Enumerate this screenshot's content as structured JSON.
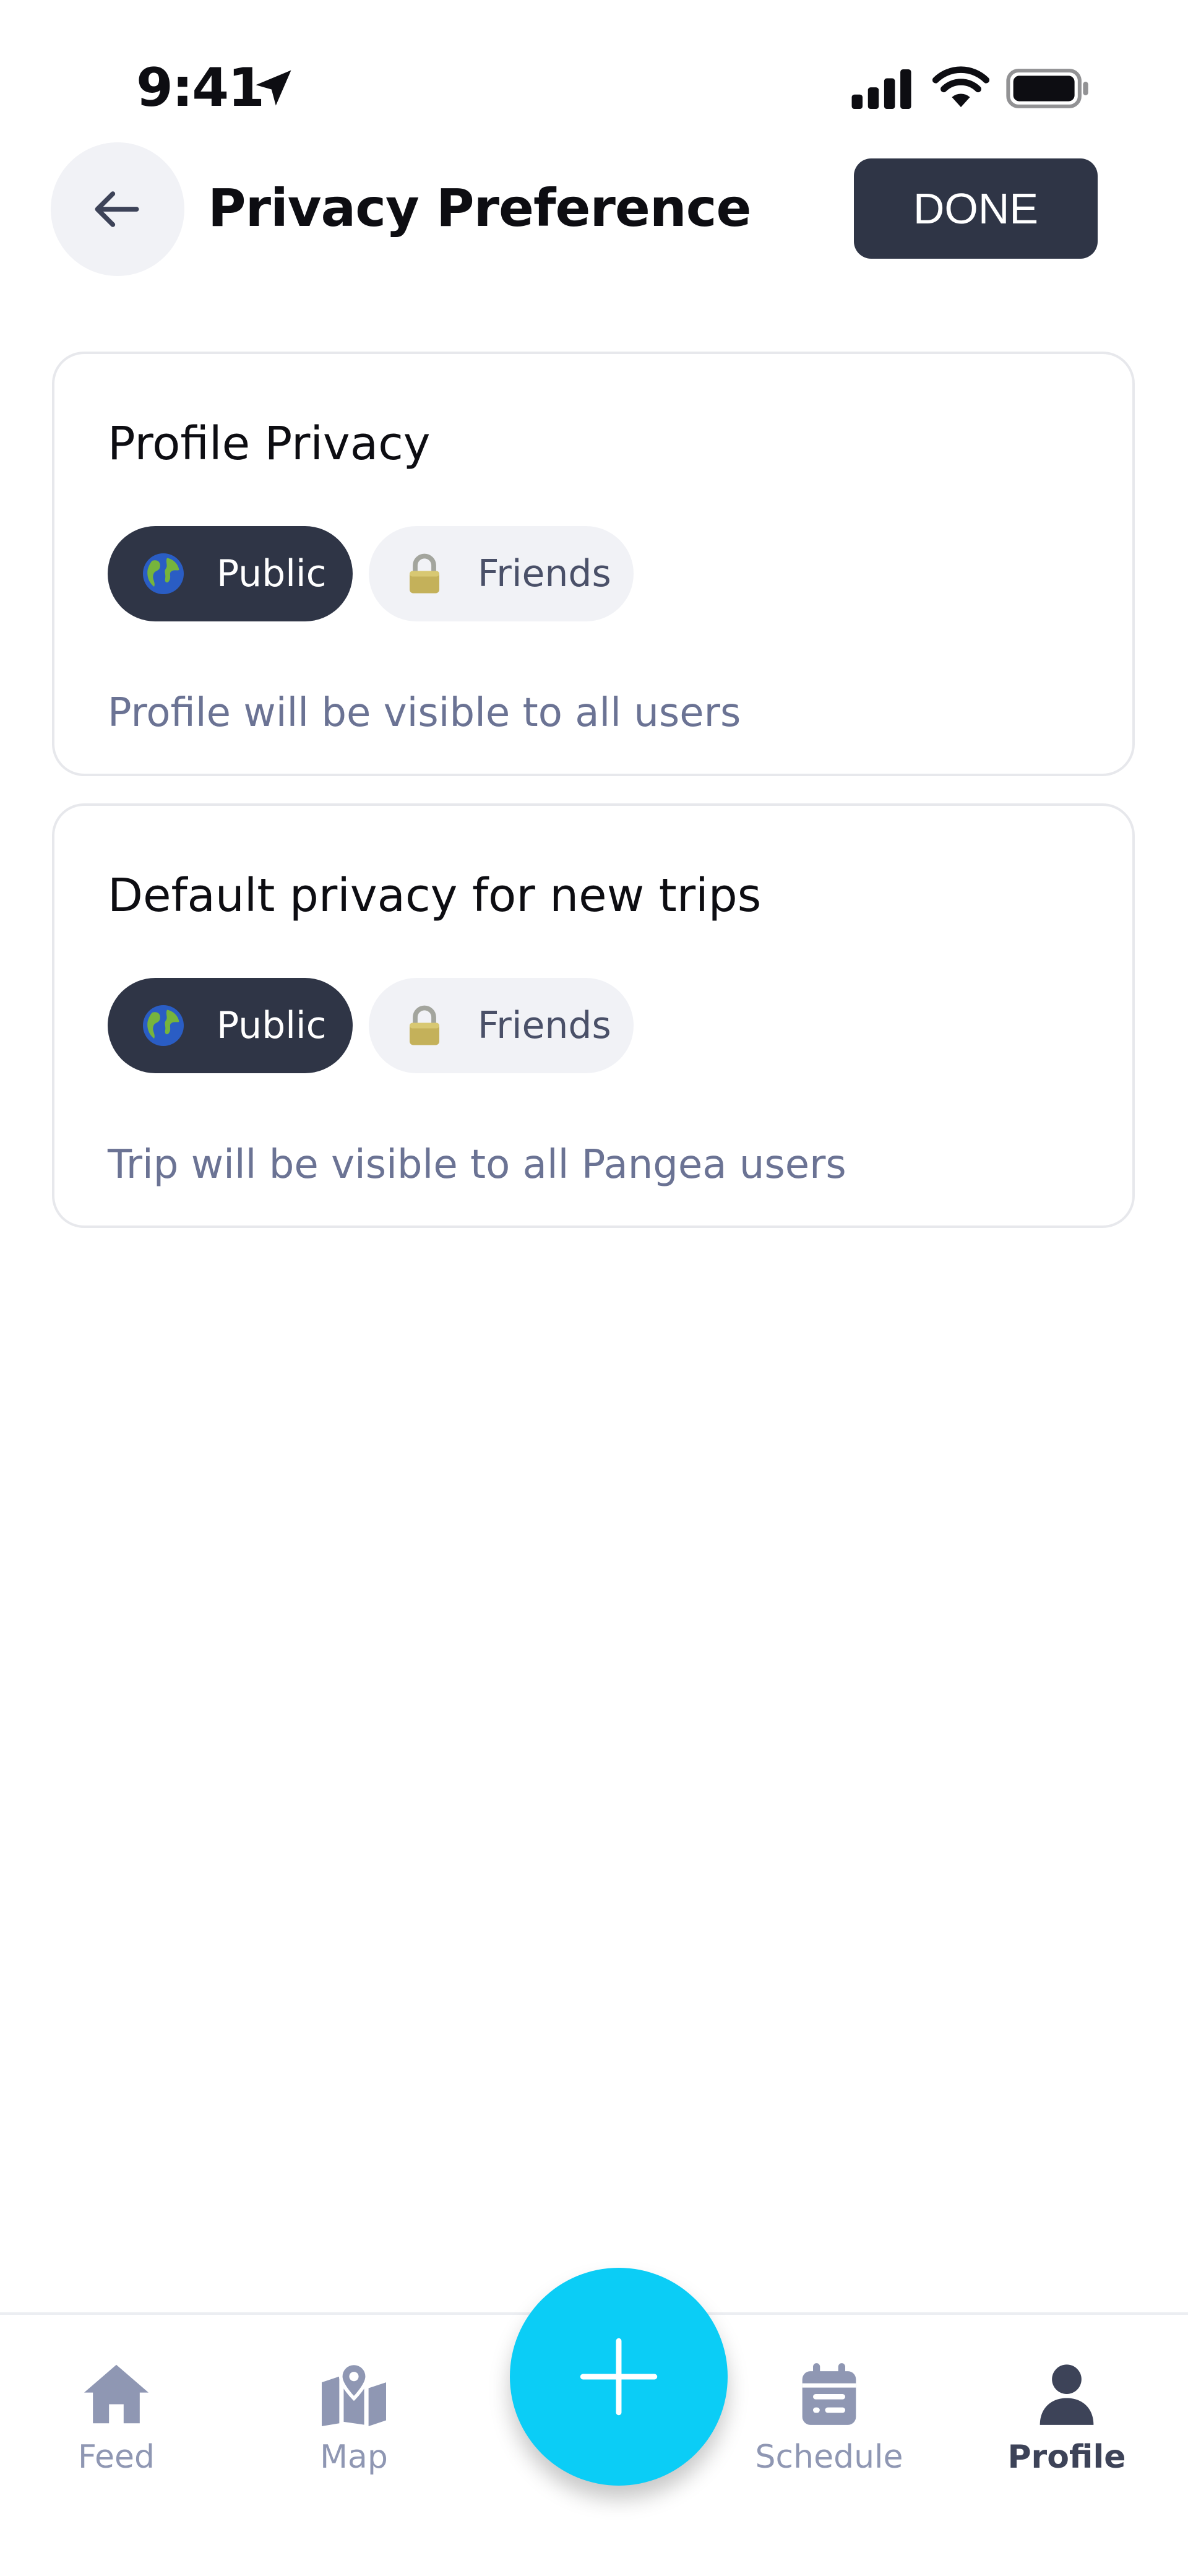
{
  "status_bar": {
    "time": "9:41",
    "icons": [
      "location-arrow-icon",
      "cellular-signal-icon",
      "wifi-icon",
      "battery-icon"
    ]
  },
  "header": {
    "back_icon": "arrow-left-icon",
    "title": "Privacy Preference",
    "done_label": "DONE"
  },
  "sections": [
    {
      "title": "Profile Privacy",
      "options": [
        {
          "label": "Public",
          "icon": "globe-icon",
          "selected": true
        },
        {
          "label": "Friends",
          "icon": "lock-icon",
          "selected": false
        }
      ],
      "description": "Profile will be visible to all users"
    },
    {
      "title": "Default privacy for new trips",
      "options": [
        {
          "label": "Public",
          "icon": "globe-icon",
          "selected": true
        },
        {
          "label": "Friends",
          "icon": "lock-icon",
          "selected": false
        }
      ],
      "description": "Trip will be visible to all Pangea users"
    }
  ],
  "nav": {
    "items": [
      {
        "label": "Feed",
        "icon": "home-icon",
        "active": false
      },
      {
        "label": "Map",
        "icon": "map-pin-icon",
        "active": false
      },
      {
        "label": "Schedule",
        "icon": "calendar-icon",
        "active": false
      },
      {
        "label": "Profile",
        "icon": "user-icon",
        "active": true
      }
    ],
    "fab_icon": "plus-icon"
  },
  "colors": {
    "primary_dark": "#2f3546",
    "fab": "#0bcdf6",
    "pill_inactive": "#f1f2f6",
    "muted_text": "#6b7394",
    "nav_inactive": "#8f97b3"
  }
}
